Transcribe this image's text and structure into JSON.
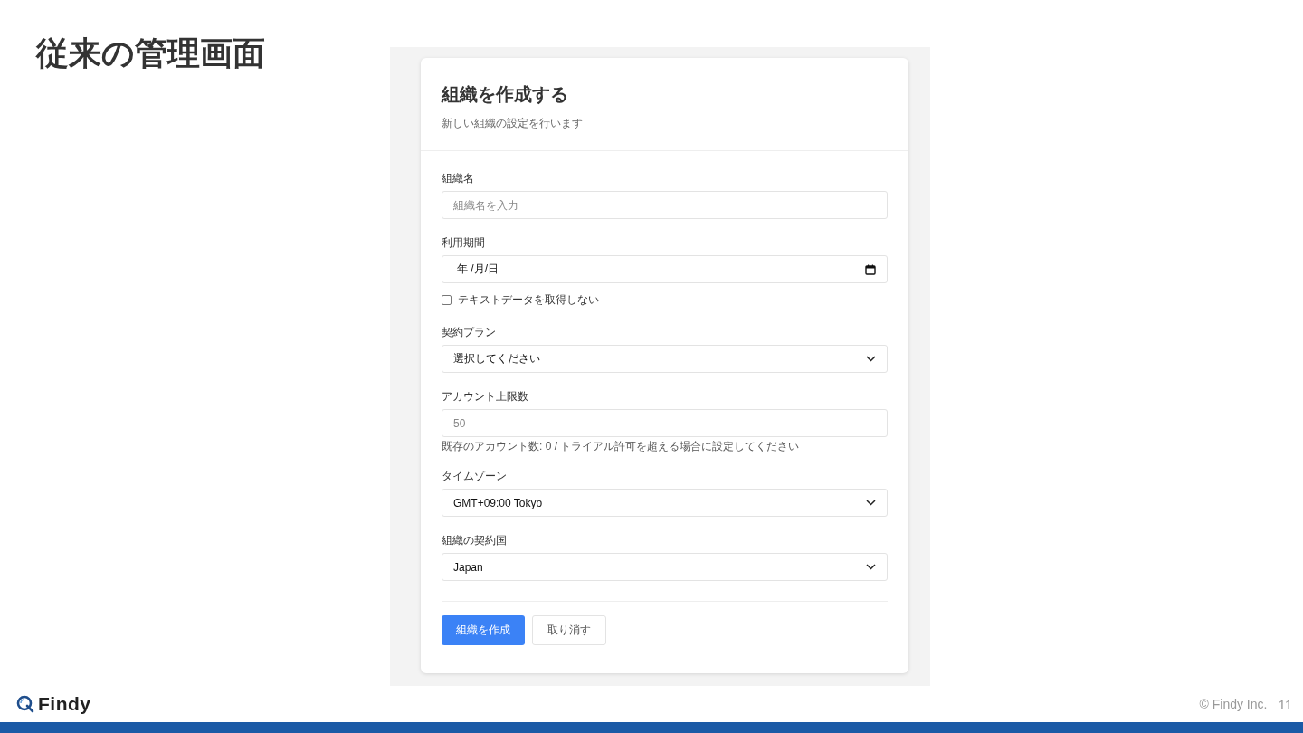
{
  "slide": {
    "title": "従来の管理画面"
  },
  "form": {
    "title": "組織を作成する",
    "subtitle": "新しい組織の設定を行います",
    "fields": [
      {
        "kind": "text",
        "label": "組織名",
        "placeholder": "組織名を入力"
      },
      {
        "kind": "date",
        "label": "利用期間",
        "value": "年 /月/日"
      },
      {
        "kind": "checkbox",
        "text": "テキストデータを取得しない",
        "checked": false
      },
      {
        "kind": "select",
        "label": "契約プラン",
        "value": "選択してください"
      },
      {
        "kind": "number",
        "label": "アカウント上限数",
        "placeholder": "50",
        "hint": "既存のアカウント数: 0 / トライアル許可を超える場合に設定してください"
      },
      {
        "kind": "select",
        "label": "タイムゾーン",
        "value": "GMT+09:00 Tokyo"
      },
      {
        "kind": "select",
        "label": "組織の契約国",
        "value": "Japan"
      }
    ],
    "buttons": [
      {
        "kind": "primary",
        "label": "組織を作成"
      },
      {
        "kind": "secondary",
        "label": "取り消す"
      }
    ]
  },
  "footer": {
    "brand": "Findy",
    "copyright": "© Findy Inc.",
    "page": "11"
  }
}
